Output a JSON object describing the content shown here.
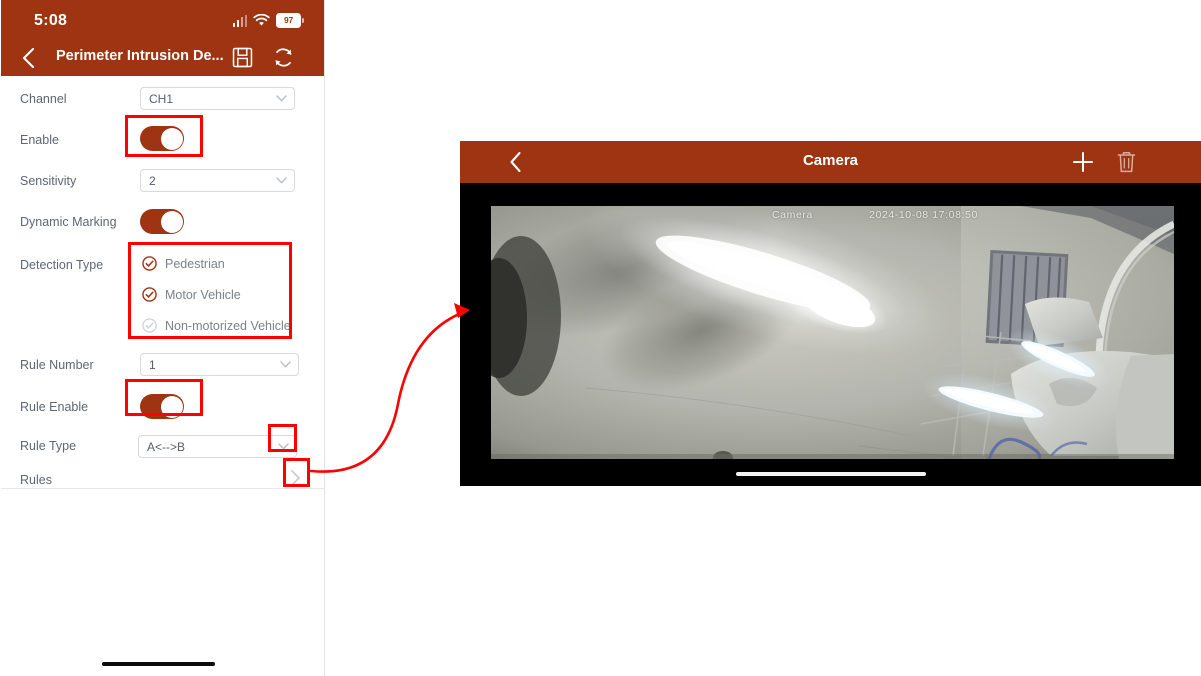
{
  "phone": {
    "status_bar": {
      "time": "5:08",
      "battery_level": "97",
      "signal_icon": "signal-bars-icon",
      "wifi_icon": "wifi-icon",
      "battery_icon": "battery-icon"
    },
    "nav": {
      "back_icon": "chevron-left-icon",
      "title": "Perimeter Intrusion De...",
      "save_icon": "save-disk-icon",
      "refresh_icon": "refresh-icon"
    },
    "form": {
      "rows": [
        {
          "label": "Channel",
          "type": "select",
          "value": "CH1"
        },
        {
          "label": "Enable",
          "type": "toggle",
          "value": "on"
        },
        {
          "label": "Sensitivity",
          "type": "select",
          "value": "2"
        },
        {
          "label": "Dynamic Marking",
          "type": "toggle",
          "value": "on"
        },
        {
          "label": "Detection Type",
          "type": "checkgroup"
        },
        {
          "label": "Rule Number",
          "type": "select",
          "value": "1"
        },
        {
          "label": "Rule Enable",
          "type": "toggle",
          "value": "on"
        },
        {
          "label": "Rule Type",
          "type": "select",
          "value": "A<-->B"
        },
        {
          "label": "Rules",
          "type": "link",
          "value": ""
        }
      ],
      "detection_types": [
        {
          "label": "Pedestrian",
          "checked": true
        },
        {
          "label": "Motor Vehicle",
          "checked": true
        },
        {
          "label": "Non-motorized Vehicle",
          "checked": false
        }
      ],
      "rules_chevron_icon": "chevron-right-icon"
    }
  },
  "camera": {
    "nav": {
      "back_icon": "chevron-left-icon",
      "title": "Camera",
      "add_icon": "plus-icon",
      "delete_icon": "trash-icon"
    },
    "video_osd": {
      "channel_name": "Camera",
      "timestamp": "2024-10-08 17:08:50"
    }
  },
  "annotations": {
    "highlight_color": "#FF0000",
    "arrow_icon": "curved-arrow-icon",
    "boxes": [
      {
        "target": "enable-toggle"
      },
      {
        "target": "detection-type-group"
      },
      {
        "target": "rule-enable-toggle"
      },
      {
        "target": "rule-type-chevron"
      },
      {
        "target": "rules-chevron"
      }
    ]
  },
  "colors": {
    "brand": "#9E3412",
    "toggle_on": "#9E3412",
    "label_text": "#5d6672",
    "annotation": "#FF0000"
  }
}
